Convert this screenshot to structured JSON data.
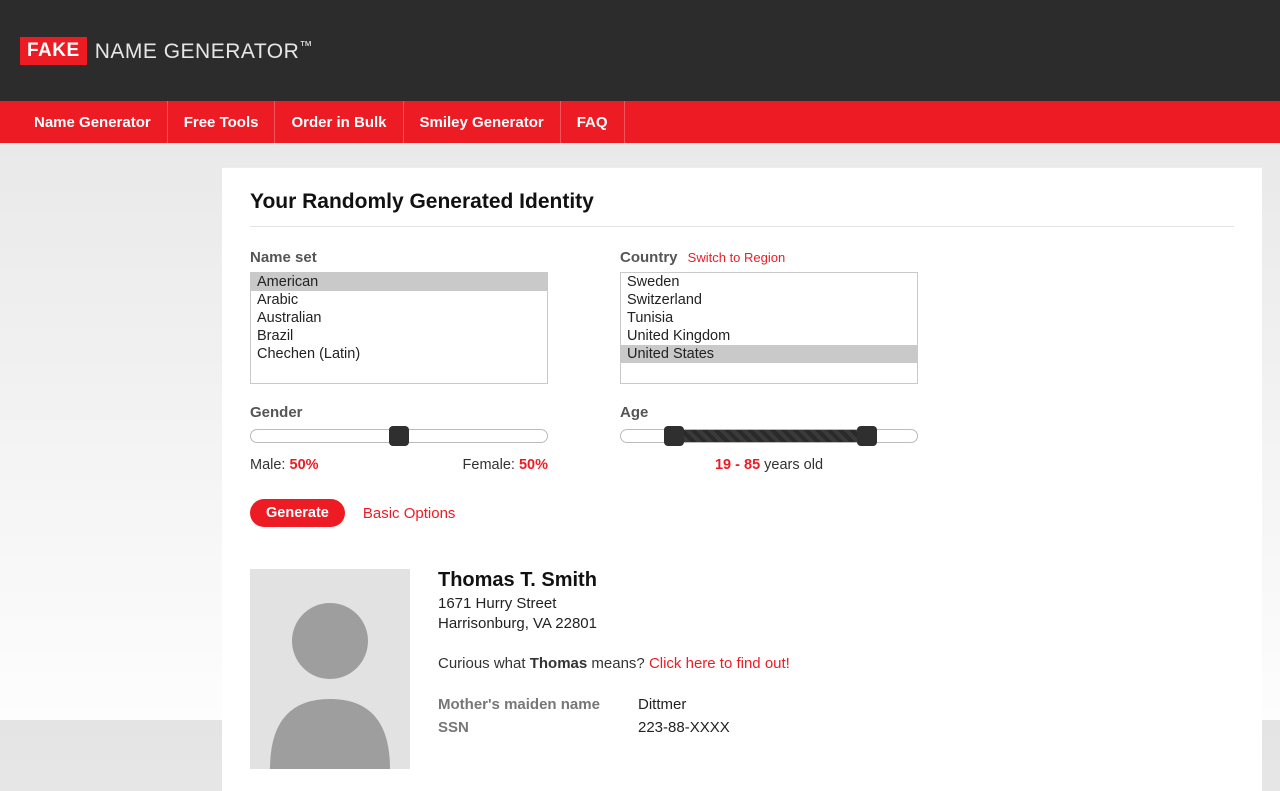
{
  "logo": {
    "badge": "FAKE",
    "rest": "NAME GENERATOR",
    "tm": "™"
  },
  "nav": [
    "Name Generator",
    "Free Tools",
    "Order in Bulk",
    "Smiley Generator",
    "FAQ"
  ],
  "heading": "Your Randomly Generated Identity",
  "nameset": {
    "label": "Name set",
    "options": [
      "American",
      "Arabic",
      "Australian",
      "Brazil",
      "Chechen (Latin)"
    ],
    "selected": "American"
  },
  "country": {
    "label": "Country",
    "switch": "Switch to Region",
    "options": [
      "Sweden",
      "Switzerland",
      "Tunisia",
      "United Kingdom",
      "United States"
    ],
    "selected": "United States"
  },
  "gender": {
    "label": "Gender",
    "male_label": "Male:",
    "male_pct": "50%",
    "female_label": "Female:",
    "female_pct": "50%"
  },
  "age": {
    "label": "Age",
    "min": "19",
    "sep": " - ",
    "max": "85",
    "suffix": " years old"
  },
  "actions": {
    "generate": "Generate",
    "basic": "Basic Options"
  },
  "identity": {
    "name": "Thomas T. Smith",
    "street": "1671 Hurry Street",
    "citystate": "Harrisonburg, VA 22801",
    "curious_prefix": "Curious what ",
    "curious_name": "Thomas",
    "curious_suffix": " means? ",
    "curious_link": "Click here to find out!",
    "details": [
      {
        "k": "Mother's maiden name",
        "v": "Dittmer"
      },
      {
        "k": "SSN",
        "v": "223-88-XXXX"
      }
    ]
  }
}
